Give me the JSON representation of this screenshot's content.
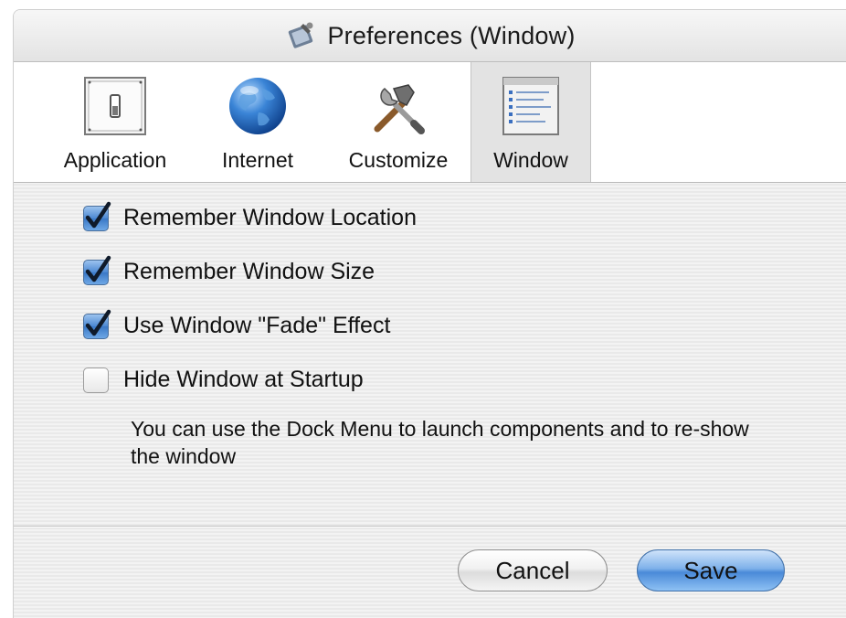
{
  "window": {
    "title": "Preferences (Window)",
    "title_icon": "preferences-wrench-icon"
  },
  "toolbar": {
    "tabs": [
      {
        "label": "Application",
        "icon": "application-switch-icon",
        "selected": false
      },
      {
        "label": "Internet",
        "icon": "globe-icon",
        "selected": false
      },
      {
        "label": "Customize",
        "icon": "tools-icon",
        "selected": false
      },
      {
        "label": "Window",
        "icon": "window-list-icon",
        "selected": true
      }
    ]
  },
  "options": [
    {
      "label": "Remember Window Location",
      "checked": true
    },
    {
      "label": "Remember Window Size",
      "checked": true
    },
    {
      "label": "Use Window \"Fade\" Effect",
      "checked": true
    },
    {
      "label": "Hide Window at Startup",
      "checked": false
    }
  ],
  "help_text": "You can use the Dock Menu to launch components and to re-show the window",
  "buttons": {
    "cancel": "Cancel",
    "save": "Save"
  },
  "colors": {
    "accent": "#4a8ad8",
    "checkbox_checked": "#3a78c6"
  }
}
